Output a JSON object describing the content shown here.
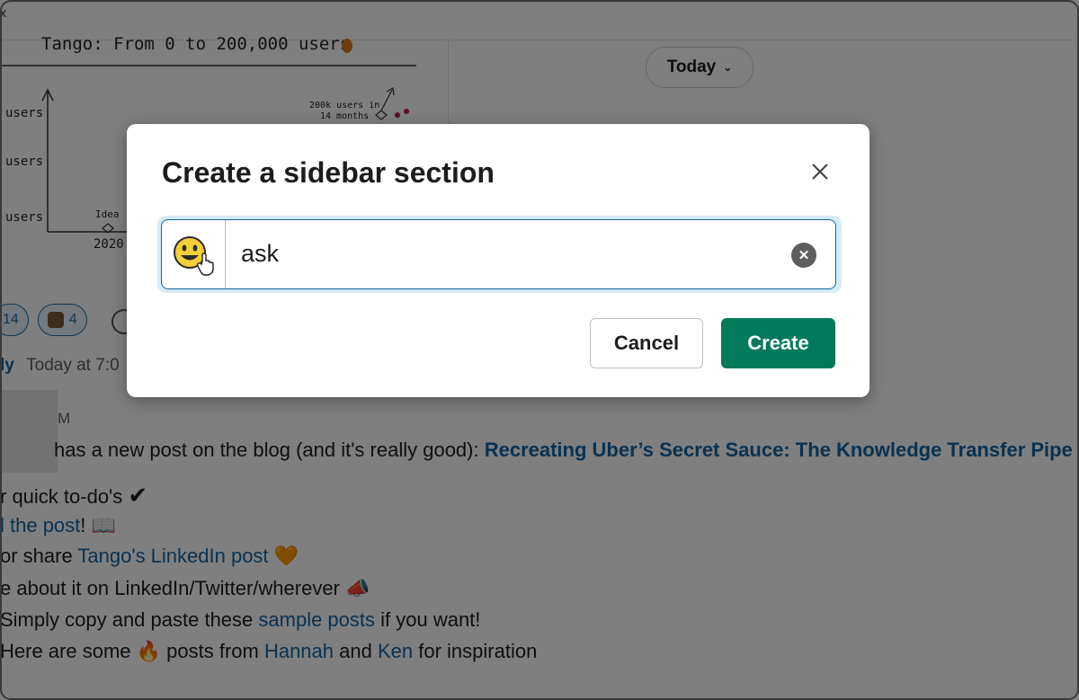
{
  "header": {
    "close_glyph": "x"
  },
  "date_filter": {
    "label": "Today"
  },
  "chart_sketch": {
    "title": "Tango: From 0 to 200,000 users",
    "y_labels": [
      "users",
      "users",
      "users"
    ],
    "idea_label": "Idea",
    "year_label": "2020",
    "annotation_line1": "200k users in",
    "annotation_line2": "14 months"
  },
  "reactions": [
    {
      "count": "14"
    },
    {
      "count": "4"
    }
  ],
  "message": {
    "author_fragment": "ly",
    "time": "Today at 7:0",
    "initial": "M",
    "blog_line_text": "has a new post on the blog (and it's really good): ",
    "blog_link": "Recreating Uber’s Secret Sauce: The Knowledge Transfer Pipe",
    "todo_text": "r quick to-do's ",
    "todo_emoji": "✔",
    "read_link": "l the post",
    "read_suffix": "! ",
    "read_emoji": "📖",
    "share_prefix": "or share ",
    "share_link": "Tango's LinkedIn post",
    "share_emoji": "🧡",
    "write_text": "e about it on LinkedIn/Twitter/wherever ",
    "write_emoji": "📣",
    "copy_prefix": "Simply copy and paste these ",
    "copy_link": "sample posts",
    "copy_suffix": " if you want!",
    "here_prefix": "Here are some ",
    "here_emoji": "🔥",
    "here_mid": " posts from ",
    "here_link1": "Hannah",
    "here_and": " and ",
    "here_link2": "Ken",
    "here_suffix": " for inspiration"
  },
  "modal": {
    "title": "Create a sidebar section",
    "input_value": "ask",
    "emoji_icon": "grinning-face-icon",
    "cancel_label": "Cancel",
    "create_label": "Create"
  },
  "colors": {
    "primary_green": "#007a5a",
    "link_blue": "#1264a3",
    "focus_ring": "#d5ebf8"
  }
}
